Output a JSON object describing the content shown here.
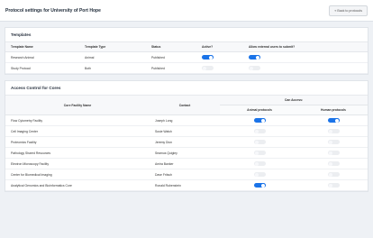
{
  "header": {
    "title": "Protocol settings for University of Port Hope",
    "back_label": "« Back to protocols"
  },
  "templates": {
    "title": "Templates",
    "columns": [
      "Template Name",
      "Template Type",
      "Status",
      "Active?",
      "Allow external users to submit?"
    ],
    "rows": [
      {
        "name": "Research Animal",
        "type": "Animal",
        "status": "Published",
        "active": true,
        "allow_external": true
      },
      {
        "name": "Study Protocol",
        "type": "Both",
        "status": "Published",
        "active": false,
        "allow_external": false
      }
    ]
  },
  "access": {
    "title": "Access Control for Cores",
    "col_core": "Core Facility Name",
    "col_contact": "Contact",
    "col_can_access": "Can Access:",
    "col_animal": "Animal protocols",
    "col_human": "Human protocols",
    "rows": [
      {
        "name": "Flow Cytometry Facility",
        "contact": "Joseph Long",
        "animal": true,
        "human": true
      },
      {
        "name": "Cell Imaging Center",
        "contact": "Susie Walsh",
        "animal": false,
        "human": false
      },
      {
        "name": "Proteomics Facility",
        "contact": "Jeremy Dion",
        "animal": false,
        "human": false
      },
      {
        "name": "Pathology Shared Resources",
        "contact": "Seamus Quigley",
        "animal": false,
        "human": false
      },
      {
        "name": "Electron Microscopy Facility",
        "contact": "Amira Banker",
        "animal": false,
        "human": false
      },
      {
        "name": "Center for Biomedical Imaging",
        "contact": "Dave Fritsch",
        "animal": false,
        "human": false
      },
      {
        "name": "Analytical Genomics and Bioinformatics Core",
        "contact": "Ronald Rubenstein",
        "animal": true,
        "human": false
      }
    ]
  }
}
